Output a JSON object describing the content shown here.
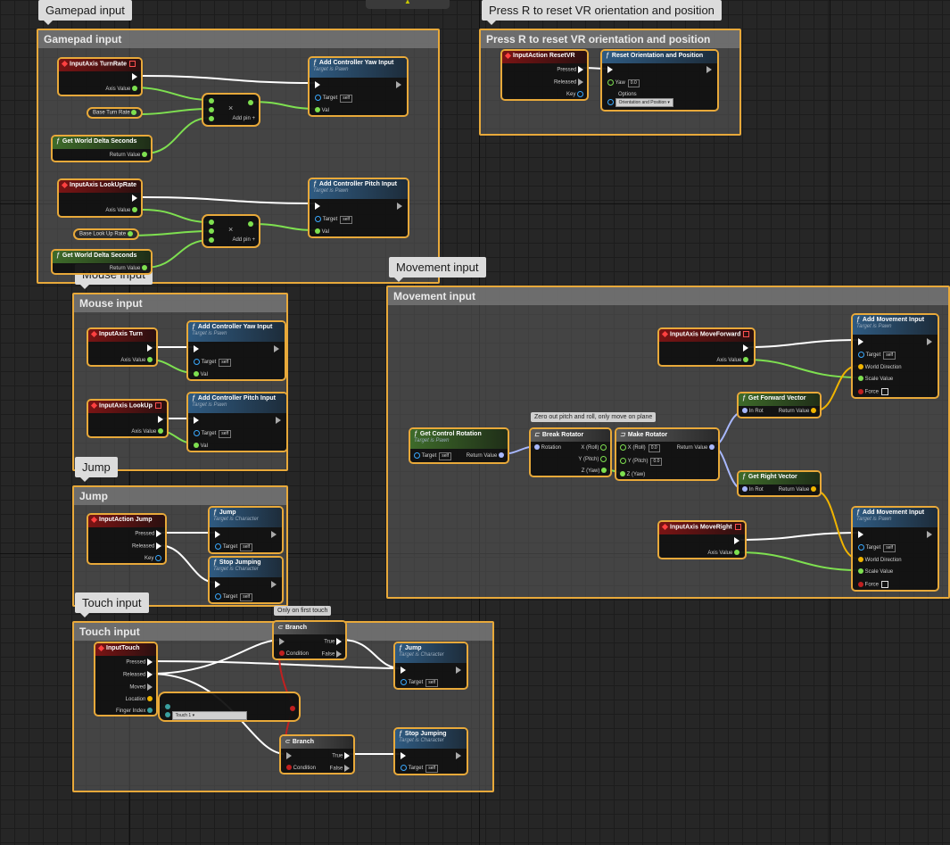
{
  "top_bar": {
    "glyph": "▲"
  },
  "comments": {
    "gamepad": "Gamepad input",
    "reset_vr": "Press R to reset VR orientation and position",
    "mouse": "Mouse input",
    "movement": "Movement input",
    "jump": "Jump",
    "touch": "Touch input",
    "zero_out": "Zero out pitch and roll, only move on plane",
    "first_touch": "Only on first touch"
  },
  "labels": {
    "input_axis_turn_rate": "InputAxis TurnRate",
    "input_axis_lookup_rate": "InputAxis LookUpRate",
    "input_axis_turn": "InputAxis Turn",
    "input_axis_lookup": "InputAxis LookUp",
    "input_axis_move_forward": "InputAxis MoveForward",
    "input_axis_move_right": "InputAxis MoveRight",
    "input_action_reset_vr": "InputAction ResetVR",
    "input_action_jump": "InputAction Jump",
    "input_touch": "InputTouch",
    "add_yaw": "Add Controller Yaw Input",
    "add_pitch": "Add Controller Pitch Input",
    "add_movement": "Add Movement Input",
    "reset_orientation": "Reset Orientation and Position",
    "get_world_delta": "Get World Delta Seconds",
    "get_control_rotation": "Get Control Rotation",
    "break_rotator": "Break Rotator",
    "make_rotator": "Make Rotator",
    "get_forward_vector": "Get Forward Vector",
    "get_right_vector": "Get Right Vector",
    "jump": "Jump",
    "stop_jumping": "Stop Jumping",
    "branch": "Branch",
    "base_turn_rate": "Base Turn Rate",
    "base_lookup_rate": "Base Look Up Rate",
    "target_is_pawn": "Target is Pawn",
    "target_is_character": "Target is Character",
    "axis_value": "Axis Value",
    "return_value": "Return Value",
    "target": "Target",
    "self": "self",
    "val": "Val",
    "add_pin": "Add pin",
    "pressed": "Pressed",
    "released": "Released",
    "moved": "Moved",
    "key": "Key",
    "location": "Location",
    "finger_index": "Finger Index",
    "yaw": "Yaw",
    "options": "Options",
    "orientation_and_position": "Orientation and Position",
    "zero": "0.0",
    "rotation": "Rotation",
    "x_roll": "X (Roll)",
    "y_pitch": "Y (Pitch)",
    "z_yaw": "Z (Yaw)",
    "in_rot": "In Rot",
    "world_direction": "World Direction",
    "scale_value": "Scale Value",
    "force": "Force",
    "condition": "Condition",
    "true": "True",
    "false": "False",
    "touch1": "Touch 1",
    "multiply": "×",
    "plus": "+"
  },
  "colors": {
    "comment_border": "#e8a93a",
    "exec_wire": "#ffffff",
    "float_wire": "#7ee050",
    "rotator_wire": "#a8b8ff",
    "vector_wire": "#f0b400",
    "bool_wire": "#c02020"
  }
}
